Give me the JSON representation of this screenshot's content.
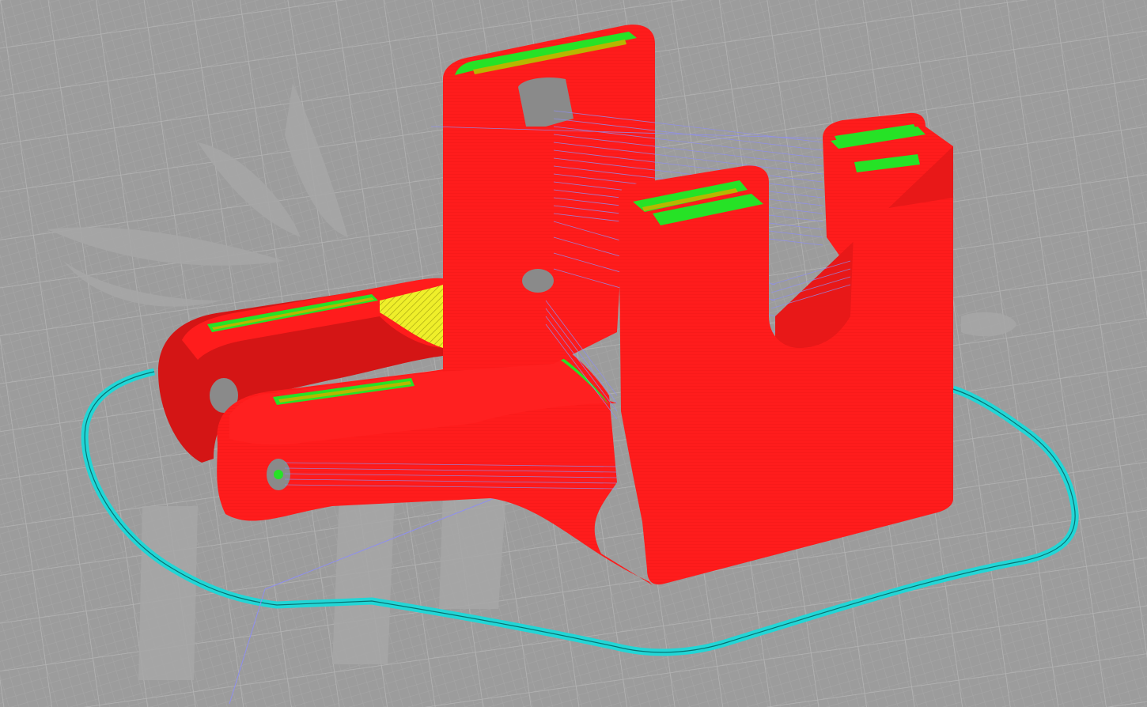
{
  "viewport": {
    "view": "gcode-preview",
    "shading": "colored-by-feature-type"
  },
  "colors": {
    "background": "#9b9b9b",
    "bed_grid_major": "#b6b6b6",
    "bed_grid_minor": "#a8a8a8",
    "bed_watermark": "#a6a6a6",
    "perimeter": "#ff1c1c",
    "perimeter_dark": "#cf1414",
    "top_solid_infill": "#26e226",
    "internal_infill": "#f0f020",
    "travel_moves": "#8f8ff0",
    "skirt": "#20dcdc"
  },
  "objects": {
    "model": "printed-part-preview",
    "skirt": "skirt-outline"
  }
}
